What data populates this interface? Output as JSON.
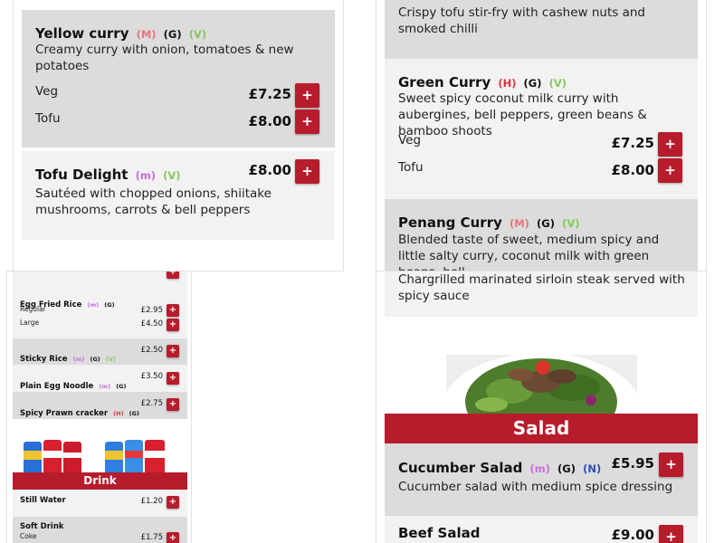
{
  "colors": {
    "accent": "#b71c2c",
    "card_grey": "#dcdcdc",
    "card_light": "#f2f2f2",
    "hot": "#e0343f",
    "medium": "#e9747a",
    "mild": "#c86fdc",
    "vegan": "#86c75c",
    "gluten": "#111111",
    "nuts": "#2b4fb5"
  },
  "add_label": "+",
  "tags": {
    "H": "(H)",
    "M": "(M)",
    "m": "(m)",
    "G": "(G)",
    "V": "(V)",
    "N": "(N)"
  },
  "panel_a": {
    "yellow_curry": {
      "name": "Yellow curry",
      "desc": "Creamy curry with onion, tomatoes & new potatoes",
      "variants": [
        {
          "label": "Veg",
          "price": "£7.25"
        },
        {
          "label": "Tofu",
          "price": "£8.00"
        }
      ]
    },
    "tofu_delight": {
      "name": "Tofu Delight",
      "price": "£8.00",
      "desc": "Sautéed with chopped onions, shiitake mushrooms, carrots & bell peppers"
    }
  },
  "panel_b": {
    "cashew_desc": "Crispy tofu stir-fry with cashew nuts and smoked chilli",
    "green_curry": {
      "name": "Green Curry",
      "desc": "Sweet spicy coconut milk curry with aubergines, bell peppers, green beans & bamboo shoots",
      "variants": [
        {
          "label": "Veg",
          "price": "£7.25"
        },
        {
          "label": "Tofu",
          "price": "£8.00"
        }
      ]
    },
    "penang_curry": {
      "name": "Penang Curry",
      "desc": "Blended taste of sweet, medium spicy and little salty curry, coconut milk with green beans, bell"
    }
  },
  "panel_c": {
    "egg_fried_rice": {
      "name": "Egg Fried Rice",
      "variants": [
        {
          "label": "Regular",
          "price": "£2.95"
        },
        {
          "label": "Large",
          "price": "£4.50"
        }
      ]
    },
    "sticky_rice": {
      "name": "Sticky Rice",
      "price": "£2.50"
    },
    "plain_noodle": {
      "name": "Plain Egg Noodle",
      "price": "£3.50"
    },
    "prawn_cracker": {
      "name": "Spicy Prawn cracker",
      "price": "£2.75"
    },
    "drink_banner": "Drink",
    "still_water": {
      "name": "Still Water",
      "price": "£1.20"
    },
    "soft_drink": {
      "name": "Soft Drink",
      "sub": "Coke",
      "price": "£1.75"
    }
  },
  "panel_d": {
    "steak_desc": "Chargrilled marinated sirloin steak served with spicy sauce",
    "salad_banner": "Salad",
    "cucumber_salad": {
      "name": "Cucumber Salad",
      "price": "£5.95",
      "desc": "Cucumber salad with medium spice dressing"
    },
    "beef_salad": {
      "name": "Beef Salad",
      "price": "£9.00"
    }
  }
}
